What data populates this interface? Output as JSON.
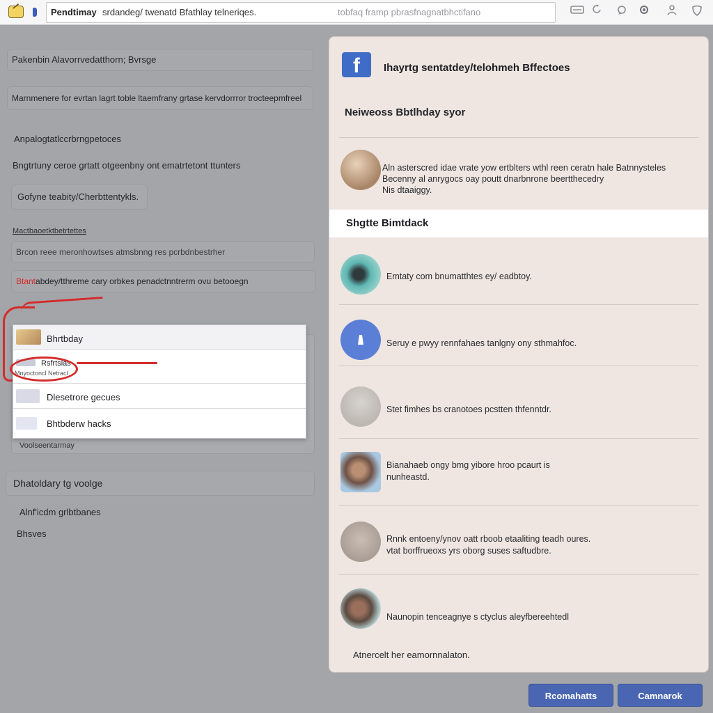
{
  "browser": {
    "address_strong": "Pendtimay",
    "address_text": "srdandeg/ twenatd Bfathlay telneriqes.",
    "address_faded": "tobfaq framp pbrasfnagnatbhctifano"
  },
  "left_panel": {
    "heading": "Pakenbin Alavorrvedatthorn; Bvrsge",
    "description": "Marnmenere for evrtan lagrt toble ltaemfrany grtase kervdorrror trocteepmfreel",
    "section_label": "Anpalogtatlccrbrngpetoces",
    "section_desc": "Bngtrtuny ceroe grtatt otgeenbny ont ematrtetont ttunters",
    "button_label": "Gofyne teabity/Cherbttentykls.",
    "small_label": "Mactbaoetktbetrtettes",
    "field_one": "Brcon reee meronhowtses atmsbnng res pcrbdnbestrher",
    "field_two_prefix": "Btant",
    "field_two": "abdey/tthreme cary orbkes penadctnntrerm ovu betooegn",
    "below_dropdown": "Voolseentarmay",
    "section2_heading": "Dhatoldary tg voolge",
    "section2_item1": "Alnf'icdm grlbtbanes",
    "section2_item2": "Bhsves"
  },
  "dropdown": {
    "items": [
      {
        "label": "Bhrtbday"
      },
      {
        "label": "Rsfrtslas",
        "sub": "Mnyoctoncl Netracl"
      },
      {
        "label": "Dlesetrore gecues"
      },
      {
        "label": "Bhtbderw hacks"
      }
    ]
  },
  "card": {
    "title": "Ihayrtg sentatdey/telohmeh Bffectoes",
    "subtitle": "Neiweoss Bbtlhday syor",
    "intro_text_line1": "Aln asterscred idae vrate yow ertblters wthl reen ceratn hale Batnnysteles",
    "intro_text_line2": "Becenny al anrygocs oay poutt dnarbnrone beertthecedry",
    "intro_text_line3": "Nis dtaaiggy.",
    "section_title": "Shgtte Bimtdack",
    "items": [
      {
        "line1": "Emtaty com bnumatthtes ey/ eadbtoy.",
        "line2": ""
      },
      {
        "line1": "Seruy e pwyy rennfahaes tanlgny ony sthmahfoc.",
        "line2": ""
      },
      {
        "line1": "Stet fimhes bs cranotoes pcstten thfenntdr.",
        "line2": ""
      },
      {
        "line1": "Bianahaeb ongy bmg yibore hroo pcaurt is",
        "line2": "nunheastd."
      },
      {
        "line1": "Rnnk entoeny/ynov oatt rboob etaaliting teadh oures.",
        "line2": "vtat borffrueoxs yrs oborg suses saftudbre."
      },
      {
        "line1": "Naunopin tenceagnye s ctyclus aleyfbereehtedl",
        "line2": ""
      }
    ],
    "footer": "Atnercelt her eamornnalaton."
  },
  "buttons": {
    "primary": "Rcomahatts",
    "secondary": "Camnarok"
  },
  "colors": {
    "accent": "#4a66b3",
    "facebook_blue": "#3f6cc6",
    "annotation_red": "#d42b2b",
    "card_bg": "#efe6e1",
    "page_bg": "#a4a5a9"
  },
  "icons": [
    "app-icon",
    "flag-icon",
    "facebook-logo-icon",
    "tab-icon",
    "refresh-icon",
    "chat-icon",
    "settings-icon",
    "user-icon",
    "shield-icon"
  ]
}
